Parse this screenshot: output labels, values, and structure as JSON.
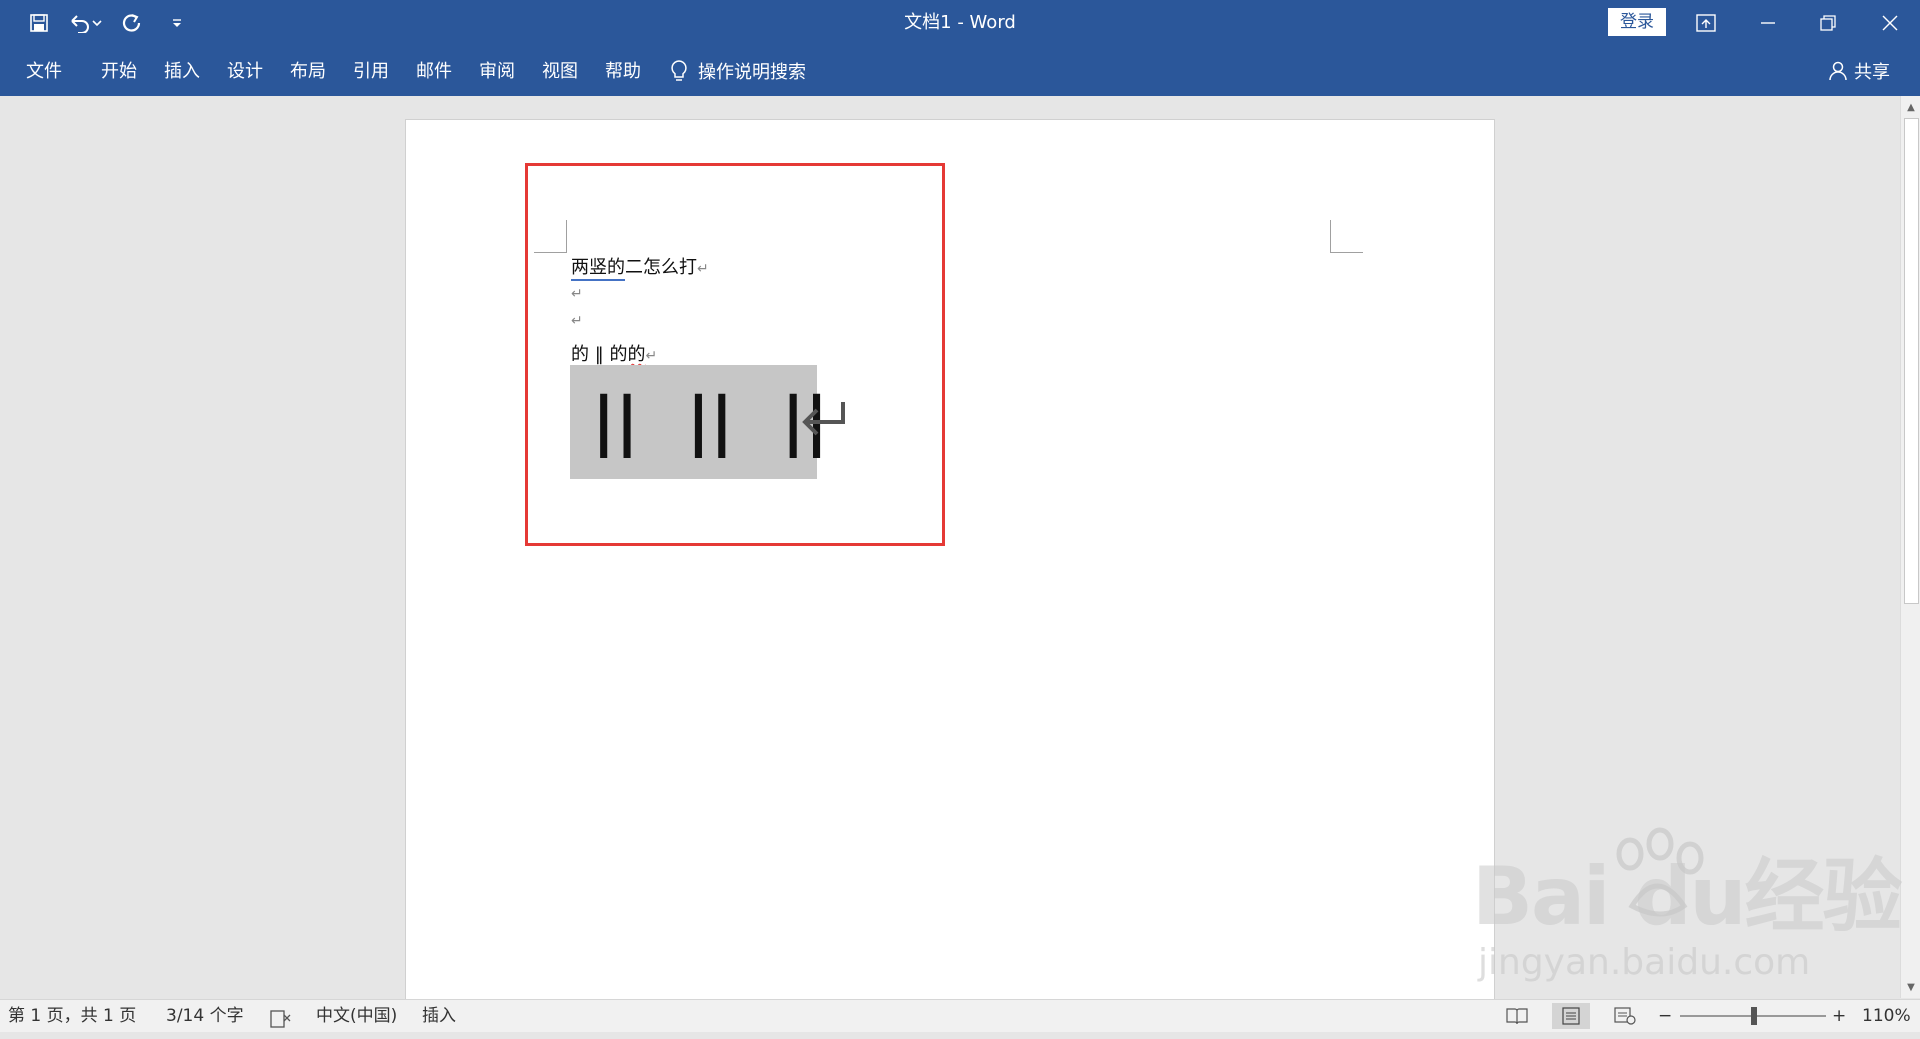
{
  "window": {
    "title": "文档1  -  Word",
    "login_label": "登录"
  },
  "ribbon": {
    "file_tab": "文件",
    "tabs": [
      "开始",
      "插入",
      "设计",
      "布局",
      "引用",
      "邮件",
      "审阅",
      "视图",
      "帮助"
    ],
    "tell_me": "操作说明搜索",
    "share": "共享"
  },
  "document": {
    "line1_underlined": "两竖的",
    "line1_rest": "二怎么打",
    "para_mark": "↵",
    "line4_pre": "的 ‖ 的",
    "line4_wavy": "的",
    "zoom_glyph": "||"
  },
  "status": {
    "page": "第 1 页，共 1 页",
    "words": "3/14 个字",
    "language": "中文(中国)",
    "mode": "插入",
    "zoom_minus": "−",
    "zoom_plus": "+",
    "zoom": "110%"
  },
  "watermark": {
    "logo": "Bai  du经验",
    "url": "jingyan.baidu.com"
  },
  "colors": {
    "brand": "#2b579a",
    "highlight": "#e53935"
  }
}
